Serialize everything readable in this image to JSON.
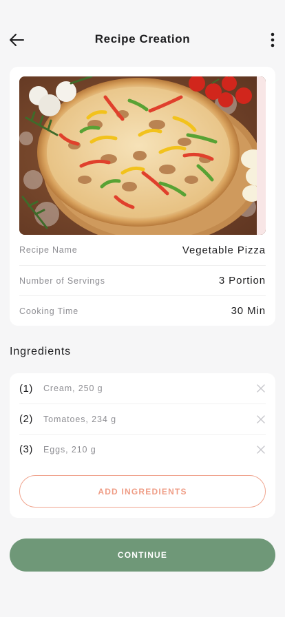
{
  "header": {
    "title": "Recipe Creation",
    "back_icon": "arrow-left-icon",
    "menu_icon": "more-vertical-icon"
  },
  "recipe": {
    "photo_alt": "vegetable-pizza-photo",
    "details": [
      {
        "label": "Recipe Name",
        "value": "Vegetable Pizza"
      },
      {
        "label": "Number of Servings",
        "value": "3 Portion"
      },
      {
        "label": "Cooking Time",
        "value": "30 Min"
      }
    ]
  },
  "ingredients": {
    "title": "Ingredients",
    "items": [
      {
        "index": "(1)",
        "text": "Cream, 250 g"
      },
      {
        "index": "(2)",
        "text": "Tomatoes, 234 g"
      },
      {
        "index": "(3)",
        "text": "Eggs, 210 g"
      }
    ],
    "add_label": "ADD INGREDIENTS"
  },
  "actions": {
    "continue_label": "CONTINUE"
  },
  "colors": {
    "accent_green": "#6f9878",
    "accent_peach": "#ef9c85",
    "background": "#f6f6f7"
  }
}
